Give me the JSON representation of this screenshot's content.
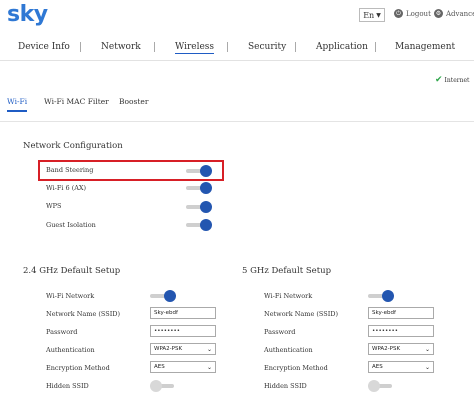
{
  "header": {
    "logo": "sky",
    "language": "En",
    "logout": "Logout",
    "advanced": "Advanced",
    "icons": {
      "logout": "power-icon",
      "advanced": "gear-icon"
    }
  },
  "nav": {
    "items": [
      "Device Info",
      "Network",
      "Wireless",
      "Security",
      "Application",
      "Management"
    ],
    "active": "Wireless"
  },
  "status": {
    "internet": "Internet",
    "color": "#2ea64a"
  },
  "subtabs": {
    "items": [
      "Wi-Fi",
      "Wi-Fi MAC Filter",
      "Booster"
    ],
    "active": "Wi-Fi"
  },
  "network_config": {
    "title": "Network Configuration",
    "rows": [
      {
        "label": "Band Steering",
        "on": true
      },
      {
        "label": "Wi-Fi 6 (AX)",
        "on": true
      },
      {
        "label": "WPS",
        "on": true
      },
      {
        "label": "Guest Isolation",
        "on": true
      }
    ]
  },
  "ghz24": {
    "title": "2.4 GHz Default Setup",
    "labels": [
      "Wi-Fi Network",
      "Network Name (SSID)",
      "Password",
      "Authentication",
      "Encryption Method",
      "Hidden SSID"
    ],
    "wifi_on": true,
    "ssid": "Sky-ebdf",
    "password": "••••••••",
    "authentication": "WPA2-PSK",
    "encryption": "AES",
    "hidden_ssid_on": false
  },
  "ghz5": {
    "title": "5 GHz Default Setup",
    "labels": [
      "Wi-Fi Network",
      "Network Name (SSID)",
      "Password",
      "Authentication",
      "Encryption Method",
      "Hidden SSID"
    ],
    "wifi_on": true,
    "ssid": "Sky-ebdf",
    "password": "••••••••",
    "authentication": "WPA2-PSK",
    "encryption": "AES",
    "hidden_ssid_on": false
  },
  "colors": {
    "accent": "#2356b0",
    "highlight": "#d71f26",
    "logo": "#2f78d4"
  }
}
